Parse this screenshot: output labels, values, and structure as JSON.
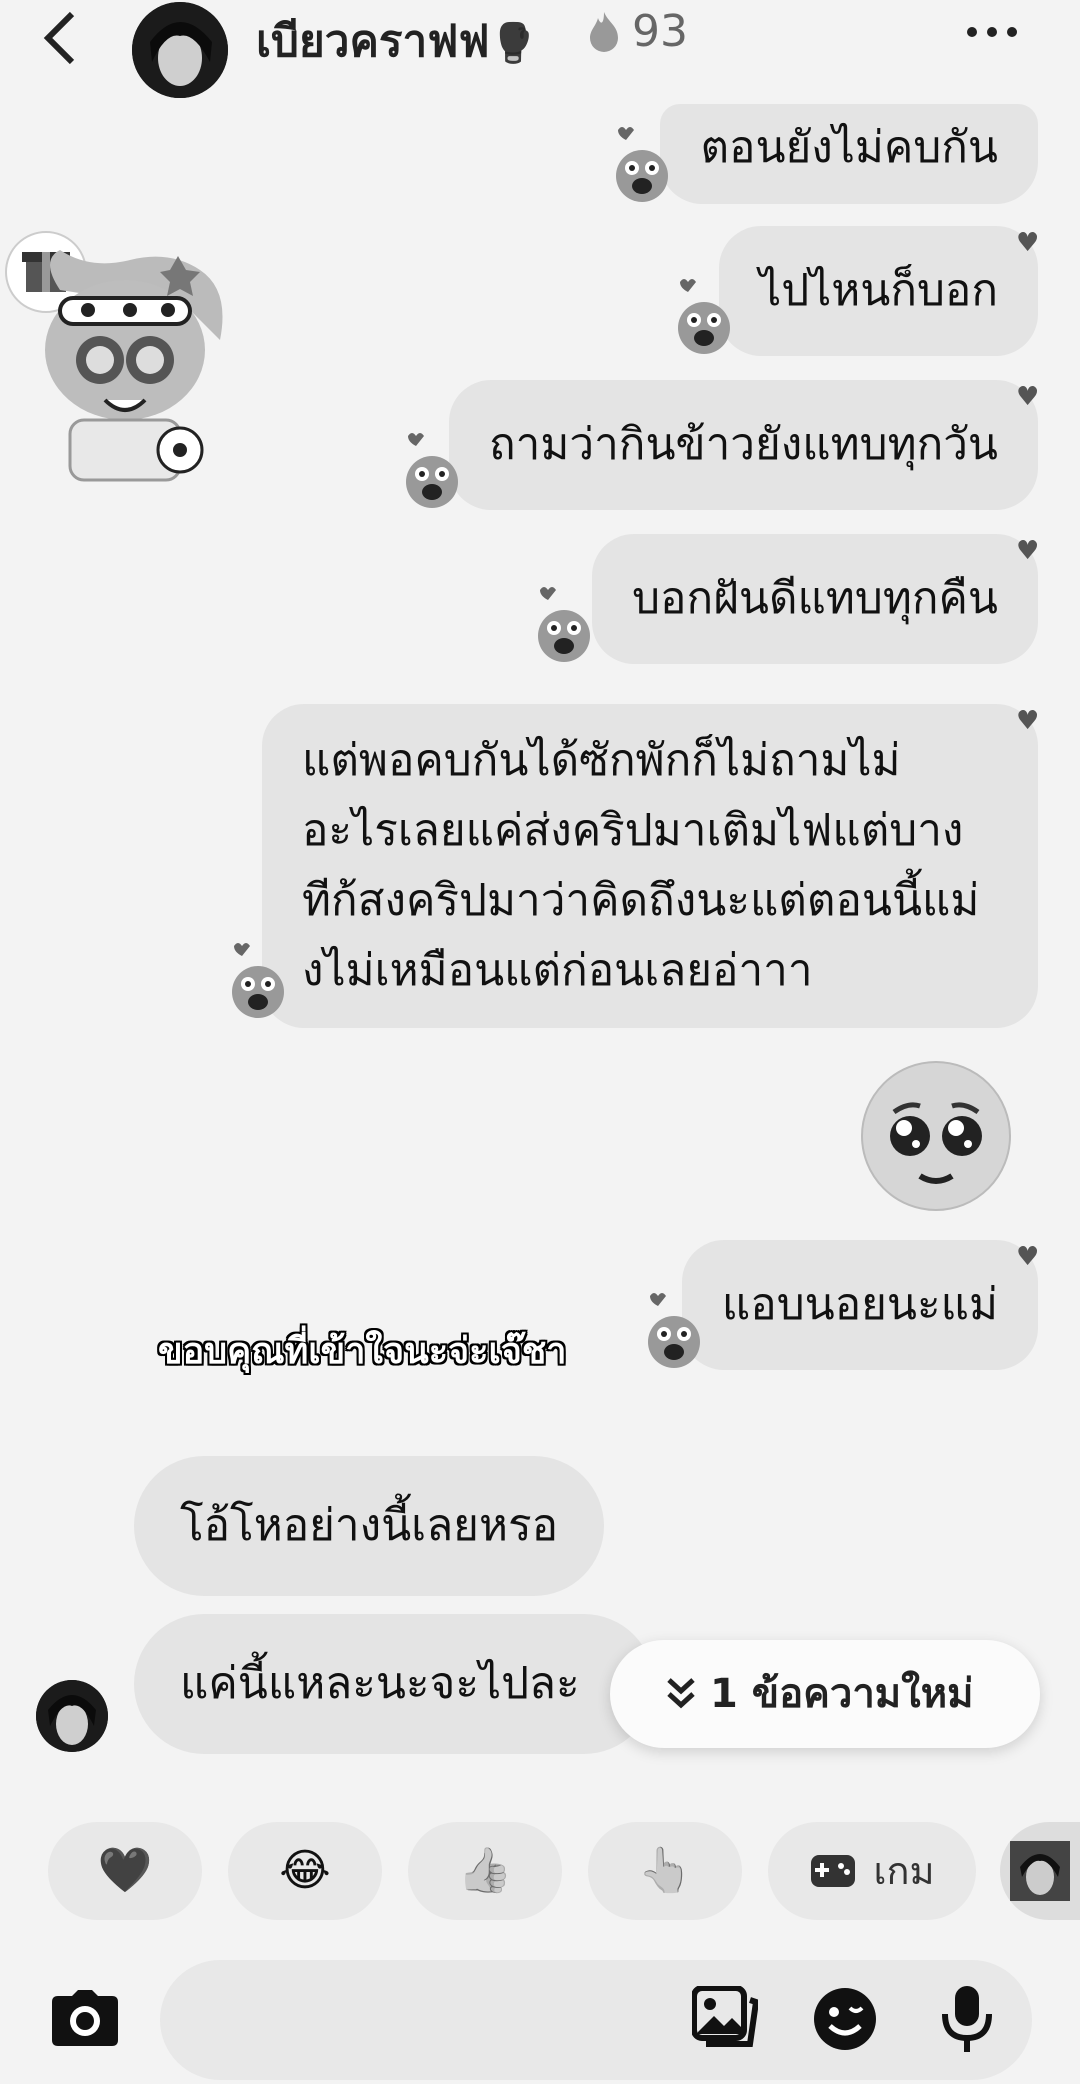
{
  "header": {
    "back_icon": "chevron-left-icon",
    "title": "เบียวคราฟฟ",
    "title_emoji": "🥊",
    "streak_icon": "fire-icon",
    "streak_count": "93",
    "more_icon": "more-icon"
  },
  "messages": {
    "m1": "ตอนยังไม่คบกัน",
    "m2": "ไปไหนก็บอก",
    "m3": "ถามว่ากินข้าวยังแทบทุกวัน",
    "m4": "บอกฝันดีแทบทุกคืน",
    "m5_line1": "แต่พอคบกันได้ซักพักก็ไม่ถามไม่",
    "m5_line2": "อะไรเลยแค่ส่งคริปมาเติมไฟแต่บาง",
    "m5_line3": "ทีก้สงคริปมาว่าคิดถึงนะแต่ตอนนี้แม่",
    "m5_line4": "งไม่เหมือนแต่ก่อนเลยอ่าาา",
    "m6_emoji": "🥺",
    "m7": "แอบนอยนะแม่",
    "overlay_caption": "ขอบคุณที่เข้าใจนะจ่ะเจ๊ชา",
    "r1": "โอ้โหอย่างนี้เลยหรอ",
    "r2": "แค่นี้แหละนะจะไปละ"
  },
  "new_messages": {
    "icon": "double-chevron-down-icon",
    "label": "1 ข้อความใหม่"
  },
  "quick_reactions": {
    "heart": "🖤",
    "laugh": "😂",
    "thumbs": "👍",
    "point": "👆",
    "game_label": "เกม",
    "game_icon": "gamepad-icon"
  },
  "input": {
    "camera_icon": "camera-icon",
    "gallery_icon": "image-icon",
    "sticker_icon": "sticker-icon",
    "mic_icon": "microphone-icon"
  },
  "colors": {
    "background": "#f3f3f3",
    "bubble": "#e4e4e4",
    "text": "#111111"
  }
}
